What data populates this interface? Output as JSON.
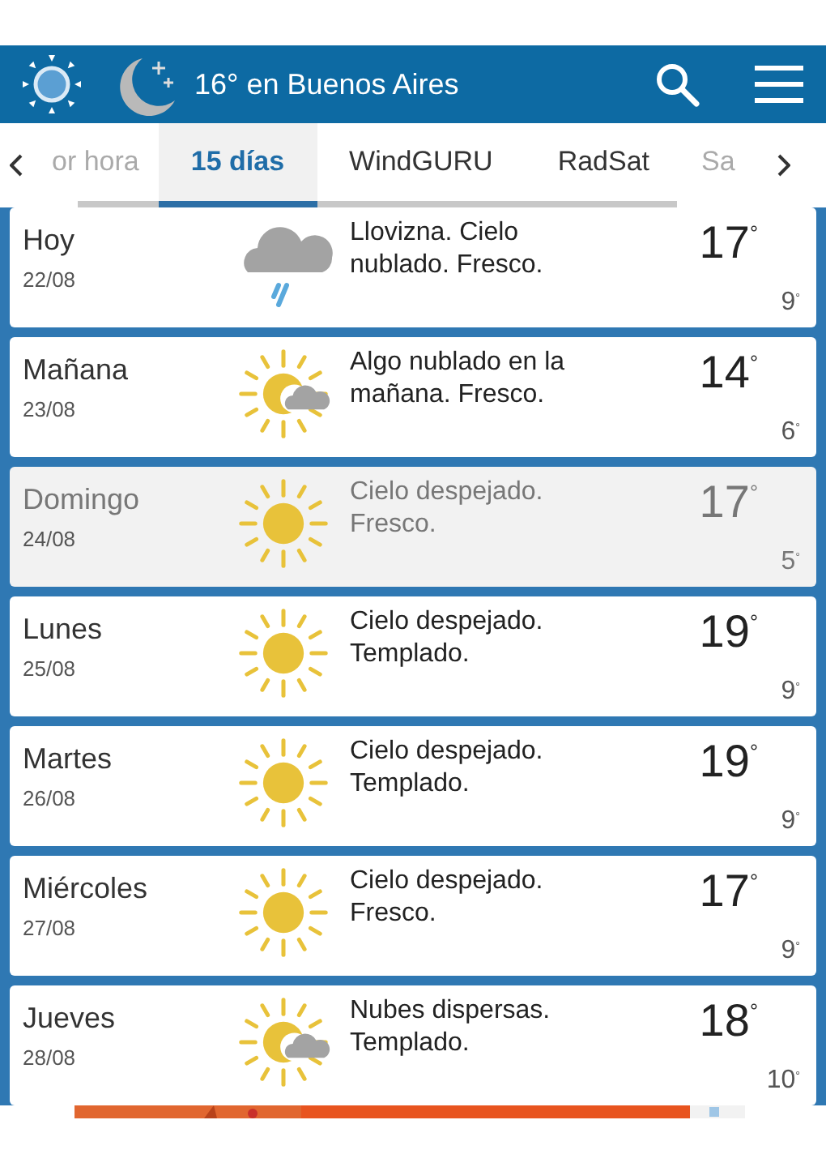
{
  "header": {
    "title": "16° en Buenos Aires"
  },
  "tabs": [
    {
      "label": "or hora",
      "selected": false
    },
    {
      "label": "15 días",
      "selected": true
    },
    {
      "label": "WindGURU",
      "selected": false
    },
    {
      "label": "RadSat",
      "selected": false
    },
    {
      "label": "Sa",
      "selected": false
    }
  ],
  "days": [
    {
      "day": "Hoy",
      "date": "22/08",
      "kind": "rain",
      "text": "Llovizna. Cielo nublado. Fresco.",
      "high": "17$^{°}$",
      "low": "9$^{°}$",
      "dimmed": false
    },
    {
      "day": "Mañana",
      "date": "23/08",
      "kind": "partly",
      "text": "Algo nublado en la mañana. Fresco.",
      "high": "14$^{°}$",
      "low": "6$^{°}$",
      "dimmed": false
    },
    {
      "day": "Domingo",
      "date": "24/08",
      "kind": "sun",
      "text": "Cielo despejado. Fresco.",
      "high": "17$^{°}$",
      "low": "5$^{°}$",
      "dimmed": true
    },
    {
      "day": "Lunes",
      "date": "25/08",
      "kind": "sun",
      "text": "Cielo despejado. Templado.",
      "high": "19$^{°}$",
      "low": "9$^{°}$",
      "dimmed": false
    },
    {
      "day": "Martes",
      "date": "26/08",
      "kind": "sun",
      "text": "Cielo despejado. Templado.",
      "high": "19$^{°}$",
      "low": "9$^{°}$",
      "dimmed": false
    },
    {
      "day": "Miércoles",
      "date": "27/08",
      "kind": "sun",
      "text": "Cielo despejado. Fresco.",
      "high": "17$^{°}$",
      "low": "9$^{°}$",
      "dimmed": false
    },
    {
      "day": "Jueves",
      "date": "28/08",
      "kind": "partly",
      "text": "Nubes dispersas. Templado.",
      "high": "18$^{°}$",
      "low": "10$^{°}$",
      "dimmed": false
    }
  ]
}
